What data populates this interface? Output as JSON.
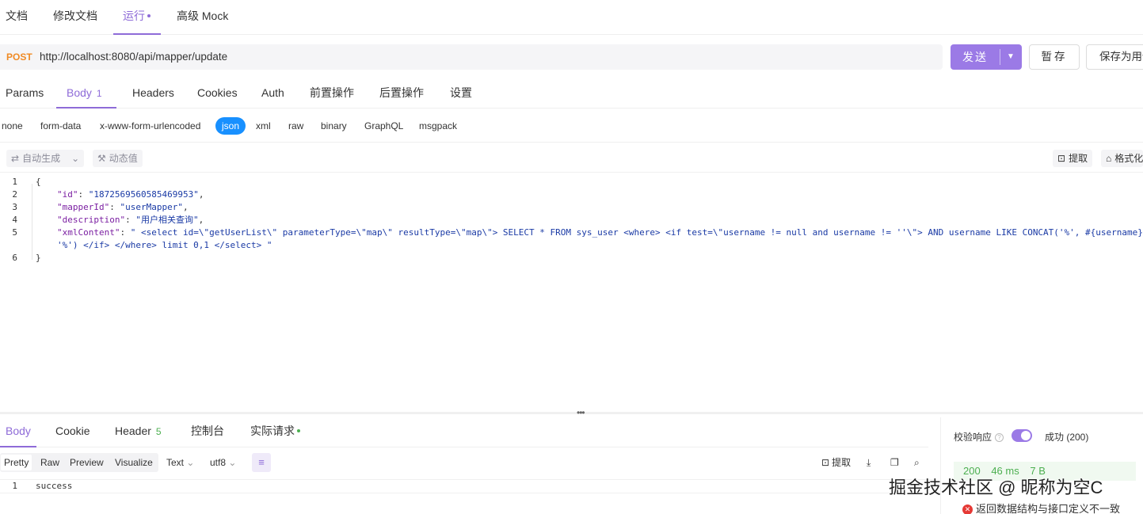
{
  "top_tabs": [
    {
      "label": "文档"
    },
    {
      "label": "修改文档"
    },
    {
      "label": "运行"
    },
    {
      "label": "高级 Mock"
    }
  ],
  "request": {
    "method": "POST",
    "url": "http://localhost:8080/api/mapper/update",
    "send_label": "发送",
    "save_label": "暂存",
    "save_as_label": "保存为用例"
  },
  "req_tabs": {
    "params": "Params",
    "body": "Body",
    "body_count": "1",
    "headers": "Headers",
    "cookies": "Cookies",
    "auth": "Auth",
    "pre": "前置操作",
    "post": "后置操作",
    "settings": "设置"
  },
  "body_types": [
    "none",
    "form-data",
    "x-www-form-urlencoded",
    "json",
    "xml",
    "raw",
    "binary",
    "GraphQL",
    "msgpack"
  ],
  "editor_toolbar": {
    "auto_generate": "自动生成",
    "dynamic_value": "动态值",
    "extract": "提取",
    "format": "格式化"
  },
  "code_lines": [
    {
      "num": "1",
      "text": "{"
    },
    {
      "num": "2",
      "key": "\"id\"",
      "value": "\"1872569560585469953\"",
      "tail": ","
    },
    {
      "num": "3",
      "key": "\"mapperId\"",
      "value": "\"userMapper\"",
      "tail": ","
    },
    {
      "num": "4",
      "key": "\"description\"",
      "value": "\"用户相关查询\"",
      "tail": ","
    },
    {
      "num": "5",
      "key": "\"xmlContent\"",
      "value": "\" <select id=\\\"getUserList\\\" parameterType=\\\"map\\\" resultType=\\\"map\\\"> SELECT * FROM sys_user <where> <if test=\\\"username != null and username != ''\\\"> AND username LIKE CONCAT('%', #{username},",
      "tail": ""
    },
    {
      "num": "",
      "text": "'%') </if> </where> limit 0,1 </select> \""
    },
    {
      "num": "6",
      "text": "}"
    }
  ],
  "resp_tabs": {
    "body": "Body",
    "cookie": "Cookie",
    "header": "Header",
    "header_count": "5",
    "console": "控制台",
    "actual": "实际请求"
  },
  "resp_toolbar": {
    "views": [
      "Pretty",
      "Raw",
      "Preview",
      "Visualize"
    ],
    "text_select": "Text",
    "encoding": "utf8",
    "extract": "提取"
  },
  "response": {
    "line_num": "1",
    "body": "success"
  },
  "right_panel": {
    "validate_label": "校验响应",
    "success_label": "成功 (200)",
    "status": "200",
    "time": "46 ms",
    "size": "7 B",
    "error": "返回数据结构与接口定义不一致"
  },
  "watermark": "掘金技术社区 @ 昵称为空C",
  "colors": {
    "accent": "#9b7ae6",
    "method": "#f08a24",
    "json_active": "#1890ff",
    "success": "#4caf50",
    "error": "#e53935"
  }
}
